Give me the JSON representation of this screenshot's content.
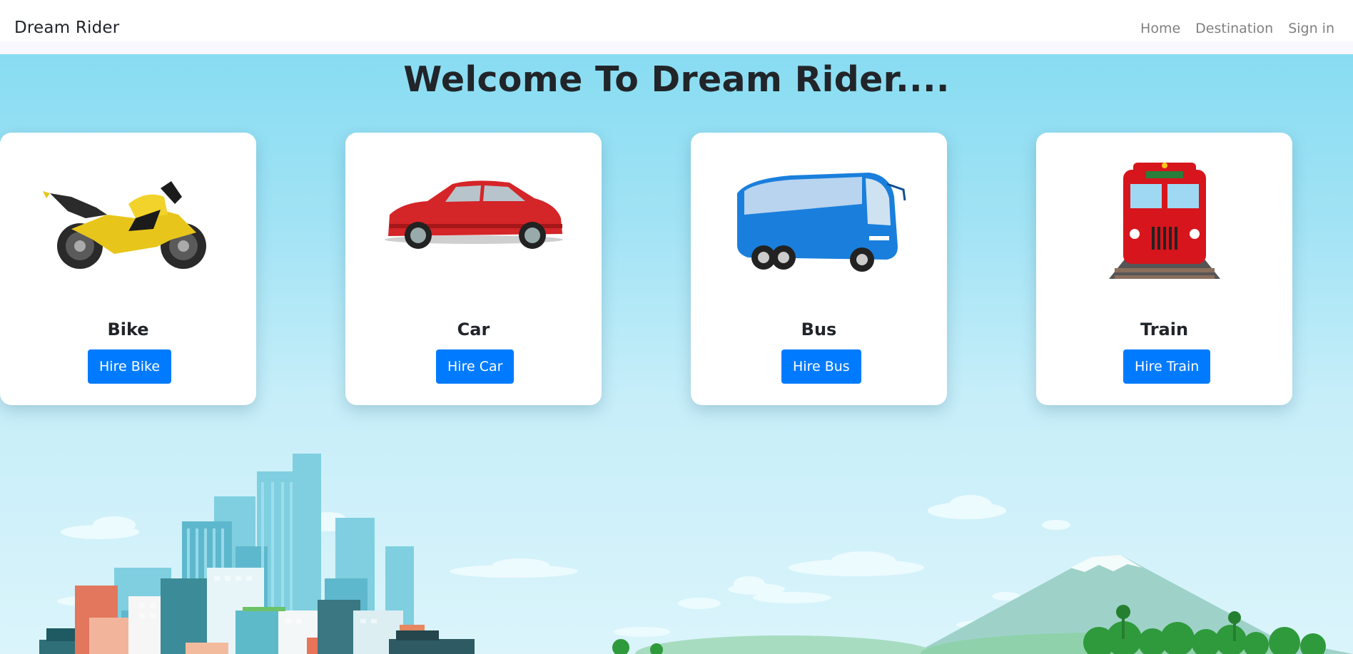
{
  "navbar": {
    "brand": "Dream Rider",
    "links": [
      "Home",
      "Destination",
      "Sign in"
    ]
  },
  "hero": {
    "title": "Welcome To Dream Rider...."
  },
  "cards": [
    {
      "name": "Bike",
      "button": "Hire Bike",
      "image": "motorcycle-image"
    },
    {
      "name": "Car",
      "button": "Hire Car",
      "image": "car-image"
    },
    {
      "name": "Bus",
      "button": "Hire Bus",
      "image": "bus-image"
    },
    {
      "name": "Train",
      "button": "Hire Train",
      "image": "train-image"
    }
  ],
  "colors": {
    "primary_button": "#007bff",
    "sky_top": "#88dcf2",
    "sky_bottom": "#dbf4fb",
    "text": "#212529",
    "nav_link": "#808080"
  }
}
